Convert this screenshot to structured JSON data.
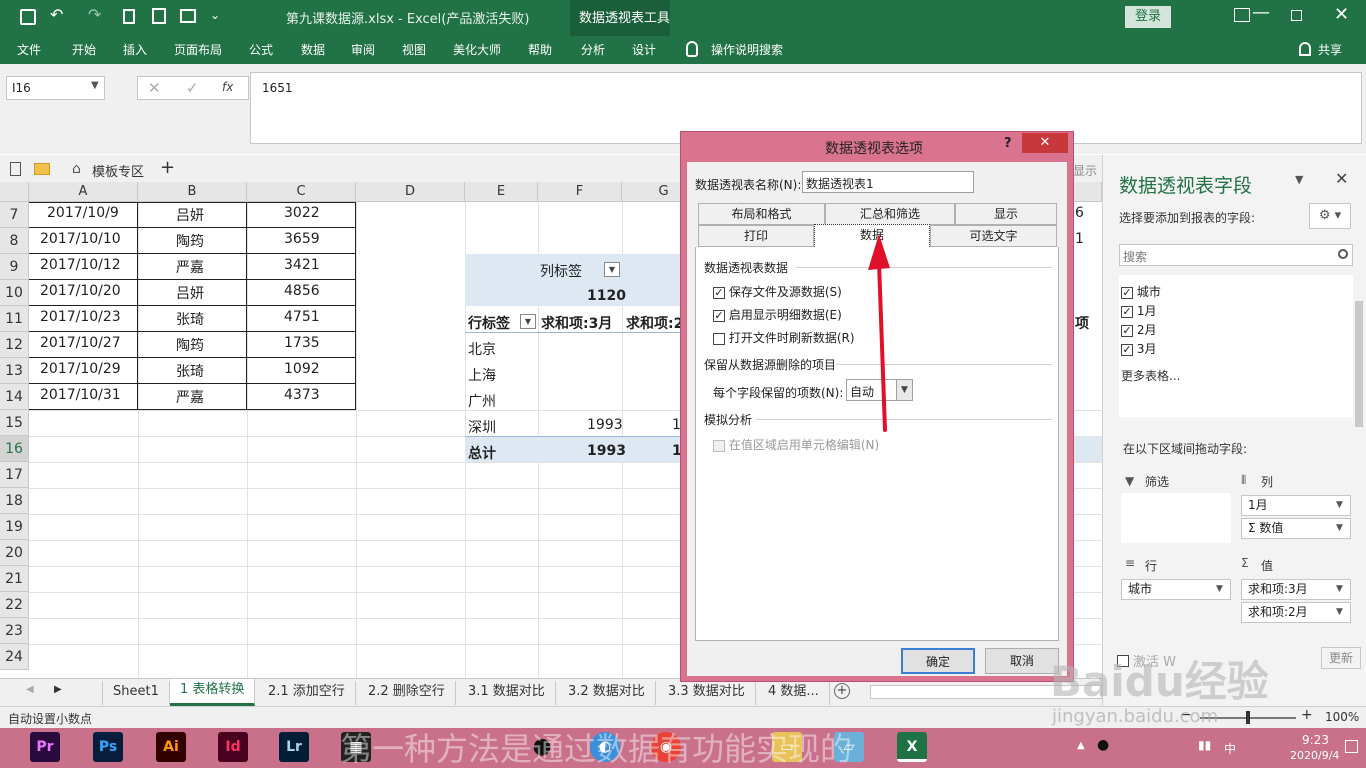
{
  "title_bar": {
    "file_title": "第九课数据源.xlsx  -  Excel(产品激活失败)",
    "context_tool": "数据透视表工具",
    "login": "登录",
    "share": "共享"
  },
  "ribbon_tabs": [
    "文件",
    "开始",
    "插入",
    "页面布局",
    "公式",
    "数据",
    "审阅",
    "视图",
    "美化大师",
    "帮助",
    "分析",
    "设计"
  ],
  "tell_me": "操作说明搜索",
  "formula_bar": {
    "name_box": "I16",
    "fx": "fx",
    "value": "1651"
  },
  "sheet_tabbar": {
    "template": "模板专区"
  },
  "columns": [
    "A",
    "B",
    "C",
    "D",
    "E",
    "F",
    "G"
  ],
  "rows": [
    "7",
    "8",
    "9",
    "10",
    "11",
    "12",
    "13",
    "14",
    "15",
    "16",
    "17",
    "18",
    "19",
    "20",
    "21",
    "22",
    "23",
    "24"
  ],
  "table": [
    {
      "date": "2017/10/9",
      "name": "吕妍",
      "amount": "3022"
    },
    {
      "date": "2017/10/10",
      "name": "陶筠",
      "amount": "3659"
    },
    {
      "date": "2017/10/12",
      "name": "严嘉",
      "amount": "3421"
    },
    {
      "date": "2017/10/20",
      "name": "吕妍",
      "amount": "4856"
    },
    {
      "date": "2017/10/23",
      "name": "张琦",
      "amount": "4751"
    },
    {
      "date": "2017/10/27",
      "name": "陶筠",
      "amount": "1735"
    },
    {
      "date": "2017/10/29",
      "name": "张琦",
      "amount": "1092"
    },
    {
      "date": "2017/10/31",
      "name": "严嘉",
      "amount": "4373"
    }
  ],
  "pivot": {
    "col_label": "列标签",
    "col_value": "1120",
    "row_label": "行标签",
    "h_march": "求和项:3月",
    "h_feb": "求和项:2",
    "cities": [
      "北京",
      "上海",
      "广州",
      "深圳"
    ],
    "shenzhen_value": "1993",
    "total_label": "总计",
    "total_value": "1993",
    "partial_g": "1",
    "right_cut_6": "6",
    "right_cut_1": "1",
    "right_cut_xiang": "项",
    "display_partial": "显示"
  },
  "dialog": {
    "title": "数据透视表选项",
    "help": "?",
    "close": "✕",
    "name_label": "数据透视表名称(N):",
    "name_value": "数据透视表1",
    "tabs_row1": [
      "布局和格式",
      "汇总和筛选",
      "显示"
    ],
    "tabs_row2": [
      "打印",
      "数据",
      "可选文字"
    ],
    "section1": "数据透视表数据",
    "opt1": "保存文件及源数据(S)",
    "opt2": "启用显示明细数据(E)",
    "opt3": "打开文件时刷新数据(R)",
    "section2": "保留从数据源删除的项目",
    "items_label": "每个字段保留的项数(N):",
    "items_value": "自动",
    "section3": "模拟分析",
    "opt4": "在值区域启用单元格编辑(N)",
    "ok": "确定",
    "cancel": "取消"
  },
  "field_panel": {
    "title": "数据透视表字段",
    "subtitle": "选择要添加到报表的字段:",
    "search_placeholder": "搜索",
    "fields": [
      "城市",
      "1月",
      "2月",
      "3月"
    ],
    "more_tables": "更多表格...",
    "drag_hint": "在以下区域间拖动字段:",
    "filter": "筛选",
    "columns": "列",
    "rows": "行",
    "values": "值",
    "col_items": [
      "1月",
      "Σ 数值"
    ],
    "row_items": [
      "城市"
    ],
    "val_items": [
      "求和项:3月",
      "求和项:2月"
    ],
    "update": "更新"
  },
  "sheet_tabs": [
    "Sheet1",
    "1 表格转换",
    "2.1 添加空行",
    "2.2 删除空行",
    "3.1 数据对比",
    "3.2 数据对比",
    "3.3 数据对比",
    "4 数据..."
  ],
  "status": {
    "left": "自动设置小数点",
    "zoom": "100%"
  },
  "overlay": {
    "subtitle": "第一种方法是通过数据有功能实现的",
    "watermark_top": "Baidu经验",
    "watermark_bottom": "jingyan.baidu.com",
    "activate": "激活 W"
  },
  "taskbar": {
    "time": "9:23",
    "date": "2020/9/4",
    "ime": "中"
  },
  "colors": {
    "excel_green": "#217346",
    "dialog_border": "#d9738e",
    "taskbar": "#c9718a",
    "arrow": "#e0102a"
  }
}
